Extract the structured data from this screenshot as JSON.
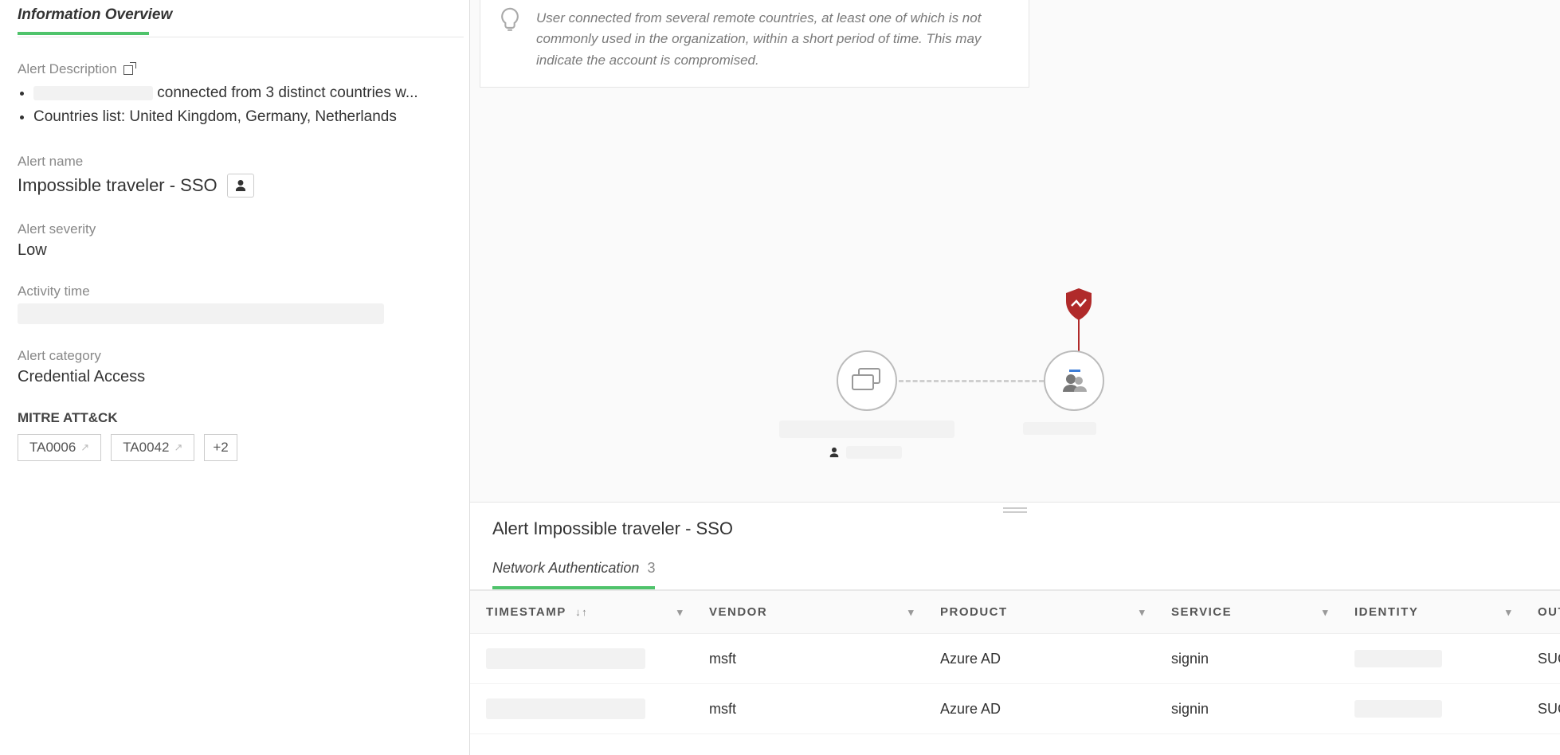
{
  "sidebar": {
    "title": "Information Overview",
    "description_label": "Alert Description",
    "bullets": [
      {
        "prefix_blur_w": 150,
        "text": "connected from 3 distinct countries w..."
      },
      {
        "prefix_blur_w": 0,
        "text": "Countries list: United Kingdom, Germany, Netherlands"
      }
    ],
    "alert_name_label": "Alert name",
    "alert_name_value": "Impossible traveler - SSO",
    "severity_label": "Alert severity",
    "severity_value": "Low",
    "activity_label": "Activity time",
    "category_label": "Alert category",
    "category_value": "Credential Access",
    "mitre_label": "MITRE ATT&CK",
    "mitre_tags": [
      "TA0006",
      "TA0042"
    ],
    "mitre_more": "+2"
  },
  "insight": {
    "text": "User connected from several remote countries, at least one of which is not commonly used in the organization, within a short period of time. This may indicate the account is compromised."
  },
  "bottom": {
    "title": "Alert Impossible traveler - SSO",
    "tab_label": "Network Authentication",
    "tab_count": "3",
    "columns": [
      "TIMESTAMP",
      "VENDOR",
      "PRODUCT",
      "SERVICE",
      "IDENTITY",
      "OUTCOME"
    ],
    "rows": [
      {
        "vendor": "msft",
        "product": "Azure AD",
        "service": "signin",
        "outcome": "SUCCESS"
      },
      {
        "vendor": "msft",
        "product": "Azure AD",
        "service": "signin",
        "outcome": "SUCCESS"
      }
    ]
  }
}
